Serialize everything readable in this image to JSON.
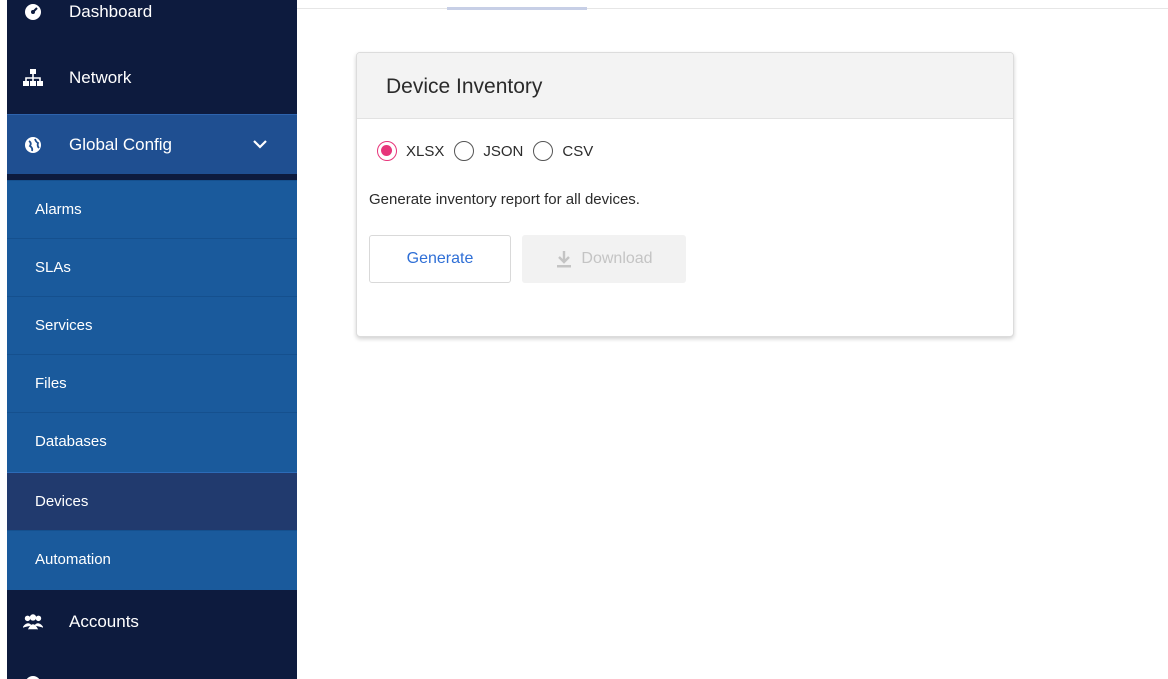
{
  "sidebar": {
    "items": {
      "dashboard": {
        "label": "Dashboard",
        "icon": "dashboard-icon"
      },
      "network": {
        "label": "Network",
        "icon": "network-icon"
      },
      "global_config": {
        "label": "Global Config",
        "icon": "globe-icon",
        "expanded": true
      },
      "accounts": {
        "label": "Accounts",
        "icon": "accounts-icon"
      }
    },
    "submenu": [
      {
        "label": "Alarms"
      },
      {
        "label": "SLAs"
      },
      {
        "label": "Services"
      },
      {
        "label": "Files"
      },
      {
        "label": "Databases"
      },
      {
        "label": "Devices",
        "active": true
      },
      {
        "label": "Automation"
      }
    ]
  },
  "card": {
    "title": "Device Inventory",
    "formats": [
      {
        "label": "XLSX",
        "checked": true
      },
      {
        "label": "JSON",
        "checked": false
      },
      {
        "label": "CSV",
        "checked": false
      }
    ],
    "description": "Generate inventory report for all devices.",
    "generate_label": "Generate",
    "download_label": "Download",
    "download_disabled": true
  },
  "colors": {
    "sidebar_bg": "#0d1b3e",
    "submenu_bg": "#1a5a9c",
    "active_item_bg": "#213a6e",
    "radio_accent": "#e7347a",
    "link_blue": "#2f6fd6"
  }
}
